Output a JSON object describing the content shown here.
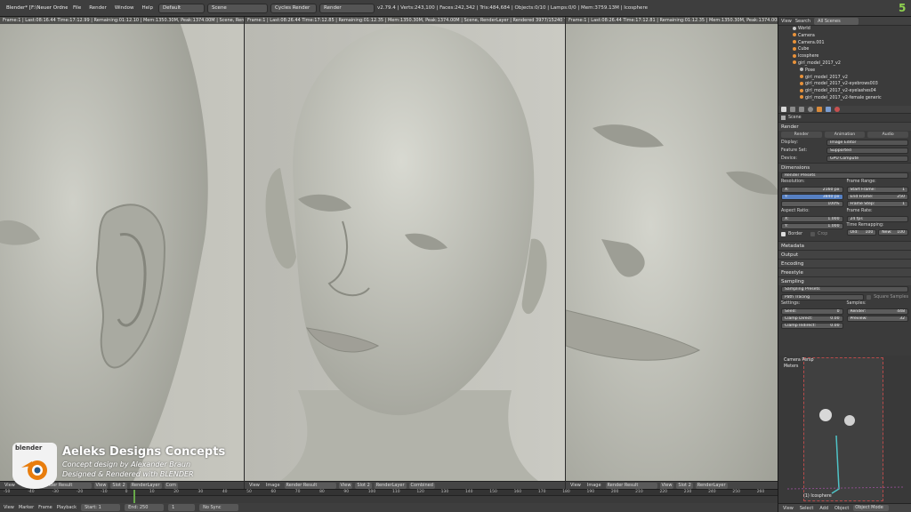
{
  "topbar": {
    "app_title": "Blender* [F:\\Neuer Ordner\\Statue_01_02.blend]",
    "menus": [
      "File",
      "Render",
      "Window",
      "Help"
    ],
    "layout": "Default",
    "scene": "Scene",
    "engine": "Cycles Render",
    "render_field": "Render",
    "stats": "v2.79.4 | Verts:243,100 | Faces:242,342 | Tris:484,684 | Objects:0/10 | Lamps:0/0 | Mem:3759.13M | Icosphere",
    "corner_icon": "5"
  },
  "views": [
    {
      "header": "Frame:1 | Last:08:16.44 Time:17:12.99 | Remaining:01:12.10 | Mem:1350.30M, Peak:1374.00M | Scene, RenderLayer | Rendered 30",
      "bar": [
        "View",
        "Image",
        "Render Result",
        "View",
        "Slot 2",
        "RenderLayer",
        "Com"
      ]
    },
    {
      "header": "Frame:1 | Last:08:26.44 Time:17:12.85 | Remaining:01:12.35 | Mem:1350.30M, Peak:1374.00M | Scene, RenderLayer | Rendered 3977/15240 Tiles",
      "bar": [
        "View",
        "Image",
        "Render Result",
        "View",
        "Slot 2",
        "RenderLayer",
        "Combined"
      ]
    },
    {
      "header": "Frame:1 | Last:08:26.44 Time:17:12.81 | Remaining:01:12.35 | Mem:1350.30M, Peak:1374.00M | Scene, RenderLayer | Rendered 3977/15240 Tiles",
      "bar": [
        "View",
        "Image",
        "Render Result",
        "View",
        "Slot 2",
        "RenderLayer"
      ]
    }
  ],
  "logo": {
    "brand": "blender",
    "title": "Aeleks Designs Concepts",
    "line1": "Concept design by Alexander Braun",
    "line2": "Designed & Rendered with BLENDER"
  },
  "timeline": {
    "ticks": [
      "-50",
      "-40",
      "-30",
      "-20",
      "-10",
      "0",
      "10",
      "20",
      "30",
      "40",
      "50",
      "60",
      "70",
      "80",
      "90",
      "100",
      "110",
      "120",
      "130",
      "140",
      "150",
      "160",
      "170",
      "180",
      "190",
      "200",
      "210",
      "220",
      "230",
      "240",
      "250",
      "260"
    ]
  },
  "bottombar": {
    "items": [
      "View",
      "Marker",
      "Frame",
      "Playback"
    ],
    "start_label": "Start:",
    "start_value": "1",
    "end_label": "End:",
    "end_value": "250",
    "current": "1",
    "sync": "No Sync"
  },
  "outliner": {
    "header": [
      "View",
      "Search",
      "All Scenes"
    ],
    "items": [
      "World",
      "Camera",
      "Camera.001",
      "Cube",
      "Icosphere",
      "girl_model_2017_v2",
      "Pose",
      "girl_model_2017_v2",
      "girl_model_2017_v2-eyebrows003",
      "girl_model_2017_v2-eyelashes04",
      "girl_model_2017_v2-female generic"
    ]
  },
  "props": {
    "scene_label": "Scene",
    "render_section": "Render",
    "render_tabs": [
      "Render",
      "Animation",
      "Audio"
    ],
    "display_label": "Display:",
    "display_value": "Image Editor",
    "feature_label": "Feature Set:",
    "feature_value": "Supported",
    "device_label": "Device:",
    "device_value": "GPU Compute",
    "dimensions_section": "Dimensions",
    "render_presets": "Render Presets",
    "resolution_label": "Resolution:",
    "res_x_label": "X:",
    "res_x": "2160 px",
    "res_y_label": "Y:",
    "res_y": "3840 px",
    "res_pct": "100%",
    "frame_range_label": "Frame Range:",
    "start_frame_label": "Start Frame:",
    "start_frame": "1",
    "end_frame_label": "End Frame:",
    "end_frame": "250",
    "frame_step_label": "Frame Step:",
    "frame_step": "1",
    "aspect_label": "Aspect Ratio:",
    "asp_x_label": "X:",
    "asp_x": "1.000",
    "asp_y_label": "Y:",
    "asp_y": "1.000",
    "frame_rate_label": "Frame Rate:",
    "frame_rate": "24 fps",
    "time_remap_label": "Time Remapping:",
    "old_label": "Old:",
    "old_value": "100",
    "new_label": "New:",
    "new_value": "100",
    "border_label": "Border",
    "crop_label": "Crop",
    "collapsed": [
      "Metadata",
      "Output",
      "Encoding",
      "Freestyle"
    ],
    "sampling_section": "Sampling",
    "sampling_presets": "Sampling Presets",
    "integrator": "Path Tracing",
    "square_samples": "Square Samples",
    "settings_label": "Settings:",
    "seed_label": "Seed:",
    "seed_value": "0",
    "clamp_direct_label": "Clamp Direct:",
    "clamp_direct": "0.00",
    "clamp_indirect_label": "Clamp Indirect:",
    "clamp_indirect": "0.00",
    "samples_label": "Samples:",
    "render_samples_label": "Render:",
    "render_samples": "448",
    "preview_samples_label": "Preview:",
    "preview_samples": "32"
  },
  "camview": {
    "label1": "Camera Persp",
    "label2": "Meters",
    "object": "(1) Icosphere",
    "bar": [
      "View",
      "Select",
      "Add",
      "Object",
      "Object Mode"
    ]
  }
}
